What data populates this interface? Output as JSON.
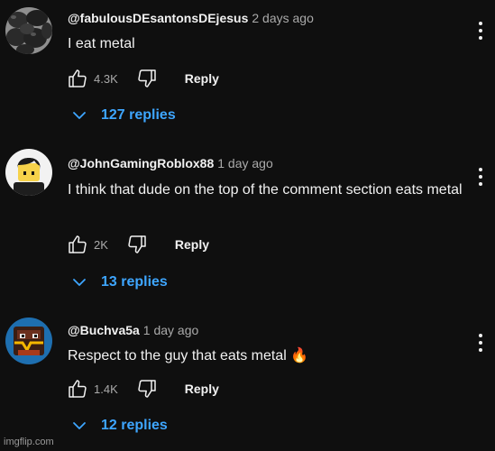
{
  "comments": [
    {
      "author": "@fabulousDEsantonsDEjesus",
      "time": "2 days ago",
      "text": "I eat metal",
      "likes": "4.3K",
      "reply_label": "Reply",
      "replies_label": "127 replies"
    },
    {
      "author": "@JohnGamingRoblox88",
      "time": "1 day ago",
      "text": "I think that dude on the top of the comment section eats metal",
      "likes": "2K",
      "reply_label": "Reply",
      "replies_label": "13 replies"
    },
    {
      "author": "@Buchva5a",
      "time": "1 day ago",
      "text": "Respect to the guy that eats metal 🔥",
      "likes": "1.4K",
      "reply_label": "Reply",
      "replies_label": "12 replies"
    }
  ],
  "watermark": "imgflip.com",
  "colors": {
    "background": "#0f0f0f",
    "primary_text": "#f1f1f1",
    "secondary_text": "#aaaaaa",
    "replies_link": "#3ea6ff"
  }
}
